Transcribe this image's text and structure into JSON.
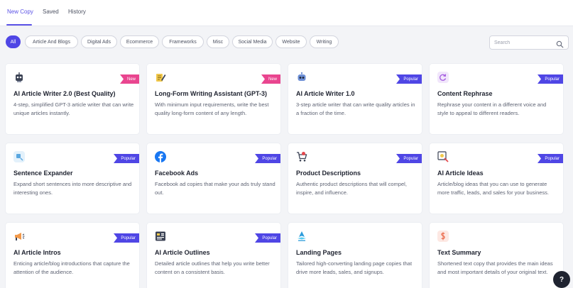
{
  "tabs": [
    {
      "label": "New Copy"
    },
    {
      "label": "Saved"
    },
    {
      "label": "History"
    }
  ],
  "filters": [
    {
      "label": "All"
    },
    {
      "label": "Article And Blogs"
    },
    {
      "label": "Digital Ads"
    },
    {
      "label": "Ecommerce"
    },
    {
      "label": "Frameworks"
    },
    {
      "label": "Misc"
    },
    {
      "label": "Social Media"
    },
    {
      "label": "Website"
    },
    {
      "label": "Writing"
    }
  ],
  "search": {
    "placeholder": "Search",
    "value": ""
  },
  "colors": {
    "accent": "#4f46e5",
    "new_badge": "#e9458f",
    "popular_badge": "#4f46e5"
  },
  "cards": [
    {
      "title": "AI Article Writer 2.0 (Best Quality)",
      "desc": "4-step, simplified GPT-3 article writer that can write unique articles instantly.",
      "badge": "New",
      "icon": "robot-icon"
    },
    {
      "title": "Long-Form Writing Assistant (GPT-3)",
      "desc": "With minimum input requirements, write the best quality long-form content of any length.",
      "badge": "New",
      "icon": "pencil-paper-icon"
    },
    {
      "title": "AI Article Writer 1.0",
      "desc": "3-step article writer that can write quality articles in a fraction of the time.",
      "badge": "Popular",
      "icon": "robot-head-icon"
    },
    {
      "title": "Content Rephrase",
      "desc": "Rephrase your content in a different voice and style to appeal to different readers.",
      "badge": "Popular",
      "icon": "refresh-icon"
    },
    {
      "title": "Sentence Expander",
      "desc": "Expand short sentences into more descriptive and interesting ones.",
      "badge": "Popular",
      "icon": "expand-icon"
    },
    {
      "title": "Facebook Ads",
      "desc": "Facebook ad copies that make your ads truly stand out.",
      "badge": "Popular",
      "icon": "facebook-icon"
    },
    {
      "title": "Product Descriptions",
      "desc": "Authentic product descriptions that will compel, inspire, and influence.",
      "badge": "Popular",
      "icon": "cart-icon"
    },
    {
      "title": "AI Article Ideas",
      "desc": "Article/blog ideas that you can use to generate more traffic, leads, and sales for your business.",
      "badge": "Popular",
      "icon": "idea-search-icon"
    },
    {
      "title": "AI Article Intros",
      "desc": "Enticing article/blog introductions that capture the attention of the audience.",
      "badge": "Popular",
      "icon": "megaphone-icon"
    },
    {
      "title": "AI Article Outlines",
      "desc": "Detailed article outlines that help you write better content on a consistent basis.",
      "badge": "Popular",
      "icon": "outline-board-icon"
    },
    {
      "title": "Landing Pages",
      "desc": "Tailored high-converting landing page copies that drive more leads, sales, and signups.",
      "badge": "",
      "icon": "rocket-icon"
    },
    {
      "title": "Text Summary",
      "desc": "Shortened text copy that provides the main ideas and most important details of your original text.",
      "badge": "",
      "icon": "summary-doc-icon"
    }
  ],
  "help": {
    "label": "?"
  }
}
